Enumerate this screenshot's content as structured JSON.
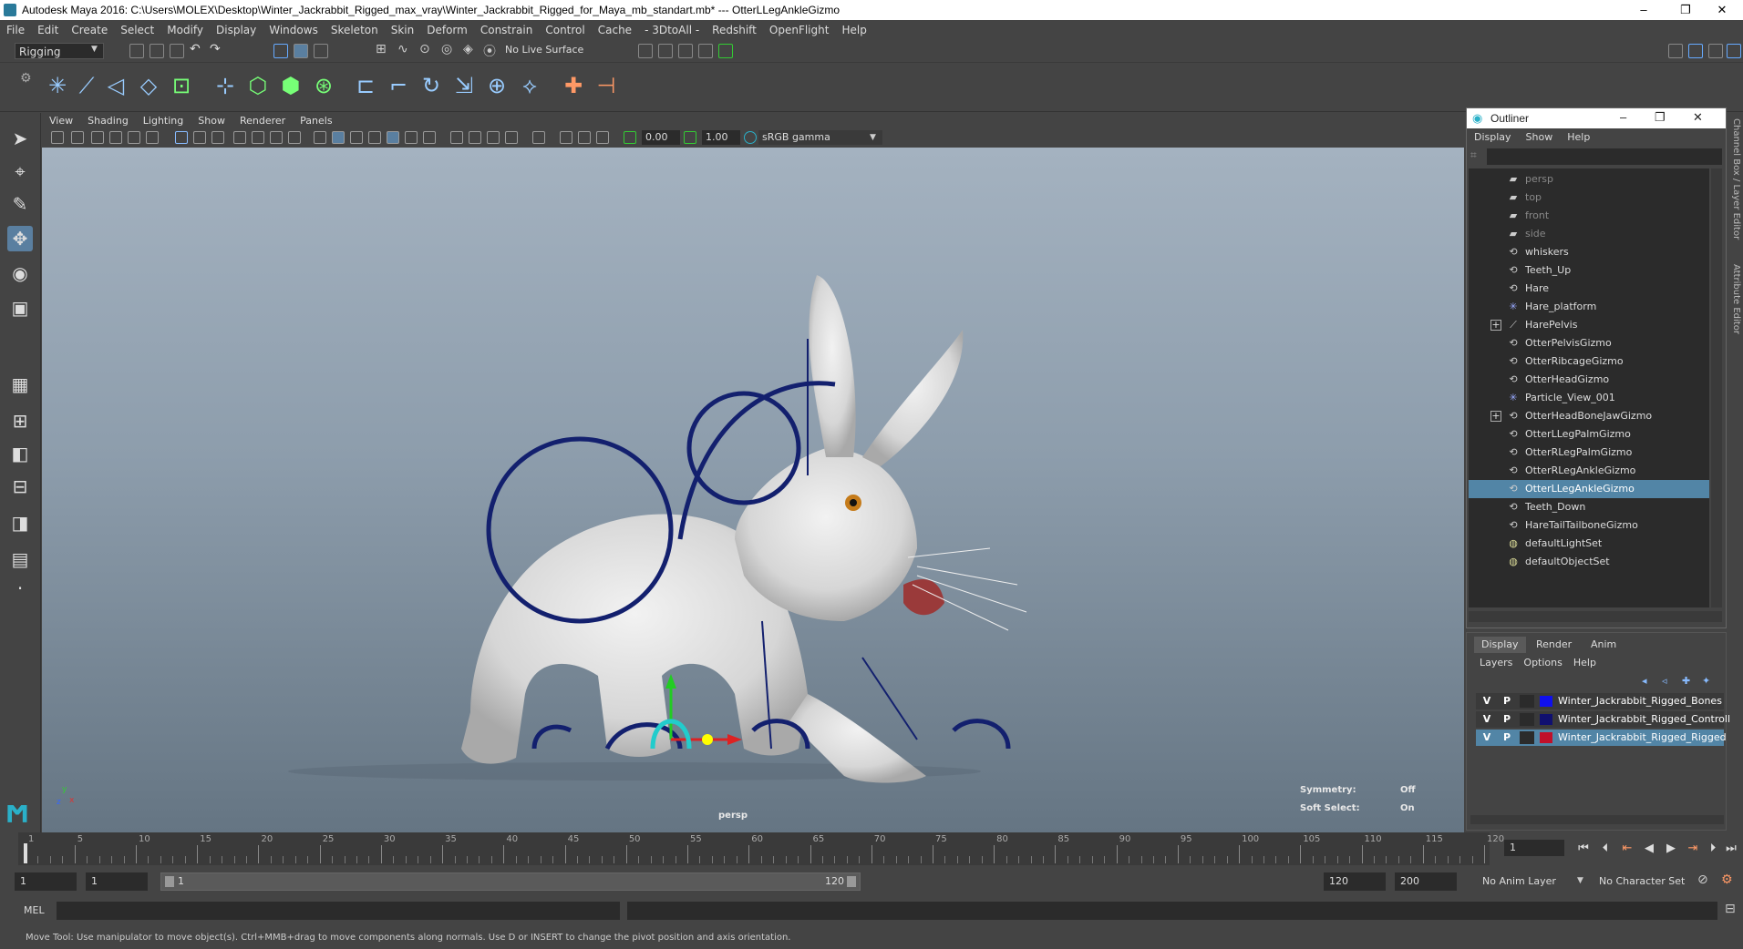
{
  "window": {
    "title": "Autodesk Maya 2016: C:\\Users\\MOLEX\\Desktop\\Winter_Jackrabbit_Rigged_max_vray\\Winter_Jackrabbit_Rigged_for_Maya_mb_standart.mb*   ---   OtterLLegAnkleGizmo",
    "minimize": "–",
    "restore": "❐",
    "close": "✕"
  },
  "menubar": [
    "File",
    "Edit",
    "Create",
    "Select",
    "Modify",
    "Display",
    "Windows",
    "Skeleton",
    "Skin",
    "Deform",
    "Constrain",
    "Control",
    "Cache",
    "- 3DtoAll -",
    "Redshift",
    "OpenFlight",
    "Help"
  ],
  "toolbar": {
    "mode": "Rigging",
    "live_surface": "No Live Surface"
  },
  "viewport": {
    "menu": [
      "View",
      "Shading",
      "Lighting",
      "Show",
      "Renderer",
      "Panels"
    ],
    "exposure": "0.00",
    "gamma": "1.00",
    "color_space": "sRGB gamma",
    "camera_label": "persp",
    "symmetry_label": "Symmetry:",
    "symmetry_value": "Off",
    "soft_select_label": "Soft Select:",
    "soft_select_value": "On",
    "axis_y": "y",
    "axis_x": "x",
    "axis_z": "z"
  },
  "outliner": {
    "title": "Outliner",
    "menu": [
      "Display",
      "Show",
      "Help"
    ],
    "items": [
      {
        "label": "persp",
        "icon": "camera",
        "dim": true
      },
      {
        "label": "top",
        "icon": "camera",
        "dim": true
      },
      {
        "label": "front",
        "icon": "camera",
        "dim": true
      },
      {
        "label": "side",
        "icon": "camera",
        "dim": true
      },
      {
        "label": "whiskers",
        "icon": "transform"
      },
      {
        "label": "Teeth_Up",
        "icon": "transform"
      },
      {
        "label": "Hare",
        "icon": "transform"
      },
      {
        "label": "Hare_platform",
        "icon": "star"
      },
      {
        "label": "HarePelvis",
        "icon": "joint",
        "expand": true
      },
      {
        "label": "OtterPelvisGizmo",
        "icon": "transform"
      },
      {
        "label": "OtterRibcageGizmo",
        "icon": "transform"
      },
      {
        "label": "OtterHeadGizmo",
        "icon": "transform"
      },
      {
        "label": "Particle_View_001",
        "icon": "star"
      },
      {
        "label": "OtterHeadBoneJawGizmo",
        "icon": "transform",
        "expand": true
      },
      {
        "label": "OtterLLegPalmGizmo",
        "icon": "transform"
      },
      {
        "label": "OtterRLegPalmGizmo",
        "icon": "transform"
      },
      {
        "label": "OtterRLegAnkleGizmo",
        "icon": "transform"
      },
      {
        "label": "OtterLLegAnkleGizmo",
        "icon": "transform",
        "selected": true
      },
      {
        "label": "Teeth_Down",
        "icon": "transform"
      },
      {
        "label": "HareTailTailboneGizmo",
        "icon": "transform"
      },
      {
        "label": "defaultLightSet",
        "icon": "set"
      },
      {
        "label": "defaultObjectSet",
        "icon": "set"
      }
    ]
  },
  "side_tabs": {
    "channel_box": "Channel Box / Layer Editor",
    "attribute_editor": "Attribute Editor"
  },
  "layers": {
    "tabs": [
      "Display",
      "Render",
      "Anim"
    ],
    "menu": [
      "Layers",
      "Options",
      "Help"
    ],
    "rows": [
      {
        "v": "V",
        "p": "P",
        "name": "Winter_Jackrabbit_Rigged_Bones",
        "color": "#1010ee"
      },
      {
        "v": "V",
        "p": "P",
        "name": "Winter_Jackrabbit_Rigged_Controll",
        "color": "#101070"
      },
      {
        "v": "V",
        "p": "P",
        "name": "Winter_Jackrabbit_Rigged_Rigged",
        "color": "#c0102a",
        "selected": true
      }
    ]
  },
  "timeline": {
    "ticks": [
      "1",
      "5",
      "10",
      "15",
      "20",
      "25",
      "30",
      "35",
      "40",
      "45",
      "50",
      "55",
      "60",
      "65",
      "70",
      "75",
      "80",
      "85",
      "90",
      "95",
      "100",
      "105",
      "110",
      "115",
      "120"
    ],
    "current_frame": "1"
  },
  "range": {
    "start": "1",
    "playback_start": "1",
    "slider_start": "1",
    "slider_end": "120",
    "playback_end": "120",
    "end": "200",
    "anim_layer": "No Anim Layer",
    "character_set": "No Character Set"
  },
  "command": {
    "language": "MEL"
  },
  "help_line": "Move Tool: Use manipulator to move object(s). Ctrl+MMB+drag to move components along normals. Use D or INSERT to change the pivot position and axis orientation."
}
